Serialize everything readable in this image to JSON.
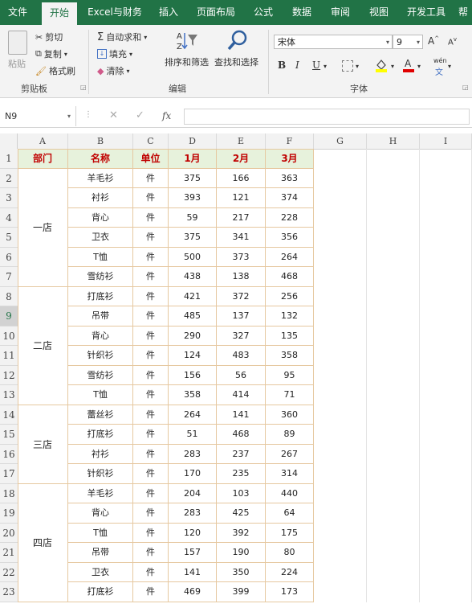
{
  "menu": {
    "tabs": [
      "文件",
      "开始",
      "Excel与财务",
      "插入",
      "页面布局",
      "公式",
      "数据",
      "审阅",
      "视图",
      "开发工具",
      "帮"
    ],
    "active": "开始"
  },
  "ribbon": {
    "clipboard": {
      "paste": "粘贴",
      "cut": "剪切",
      "copy": "复制",
      "format_painter": "格式刷",
      "group_label": "剪贴板"
    },
    "editing": {
      "autosum": "自动求和",
      "fill": "填充",
      "clear": "清除",
      "sort_filter": "排序和筛选",
      "find_select": "查找和选择",
      "group_label": "编辑"
    },
    "font": {
      "font_name": "宋体",
      "font_size": "9",
      "bold": "B",
      "italic": "I",
      "underline": "U",
      "wen": "wén",
      "group_label": "字体"
    }
  },
  "formula_bar": {
    "name_box": "N9",
    "fx": "fx",
    "value": ""
  },
  "sheet": {
    "columns": [
      "A",
      "B",
      "C",
      "D",
      "E",
      "F",
      "G",
      "H",
      "I"
    ],
    "rows": [
      "1",
      "2",
      "3",
      "4",
      "5",
      "6",
      "7",
      "8",
      "9",
      "10",
      "11",
      "12",
      "13",
      "14",
      "15",
      "16",
      "17",
      "18",
      "19",
      "20",
      "21",
      "22",
      "23"
    ],
    "selected_row": "9",
    "header": [
      "部门",
      "名称",
      "单位",
      "1月",
      "2月",
      "3月"
    ],
    "depts": [
      {
        "name": "一店",
        "start": 1,
        "span": 6
      },
      {
        "name": "二店",
        "start": 7,
        "span": 6
      },
      {
        "name": "三店",
        "start": 13,
        "span": 4
      },
      {
        "name": "四店",
        "start": 17,
        "span": 6
      }
    ],
    "data": [
      [
        "羊毛衫",
        "件",
        "375",
        "166",
        "363"
      ],
      [
        "衬衫",
        "件",
        "393",
        "121",
        "374"
      ],
      [
        "背心",
        "件",
        "59",
        "217",
        "228"
      ],
      [
        "卫衣",
        "件",
        "375",
        "341",
        "356"
      ],
      [
        "T恤",
        "件",
        "500",
        "373",
        "264"
      ],
      [
        "雪纺衫",
        "件",
        "438",
        "138",
        "468"
      ],
      [
        "打底衫",
        "件",
        "421",
        "372",
        "256"
      ],
      [
        "吊带",
        "件",
        "485",
        "137",
        "132"
      ],
      [
        "背心",
        "件",
        "290",
        "327",
        "135"
      ],
      [
        "针织衫",
        "件",
        "124",
        "483",
        "358"
      ],
      [
        "雪纺衫",
        "件",
        "156",
        "56",
        "95"
      ],
      [
        "T恤",
        "件",
        "358",
        "414",
        "71"
      ],
      [
        "蕾丝衫",
        "件",
        "264",
        "141",
        "360"
      ],
      [
        "打底衫",
        "件",
        "51",
        "468",
        "89"
      ],
      [
        "衬衫",
        "件",
        "283",
        "237",
        "267"
      ],
      [
        "针织衫",
        "件",
        "170",
        "235",
        "314"
      ],
      [
        "羊毛衫",
        "件",
        "204",
        "103",
        "440"
      ],
      [
        "背心",
        "件",
        "283",
        "425",
        "64"
      ],
      [
        "T恤",
        "件",
        "120",
        "392",
        "175"
      ],
      [
        "吊带",
        "件",
        "157",
        "190",
        "80"
      ],
      [
        "卫衣",
        "件",
        "141",
        "350",
        "224"
      ],
      [
        "打底衫",
        "件",
        "469",
        "399",
        "173"
      ]
    ]
  },
  "colors": {
    "excel_green": "#217346",
    "header_red": "#c00000",
    "header_fill": "#e7f2dc",
    "border_orange": "#e6c8a0"
  }
}
